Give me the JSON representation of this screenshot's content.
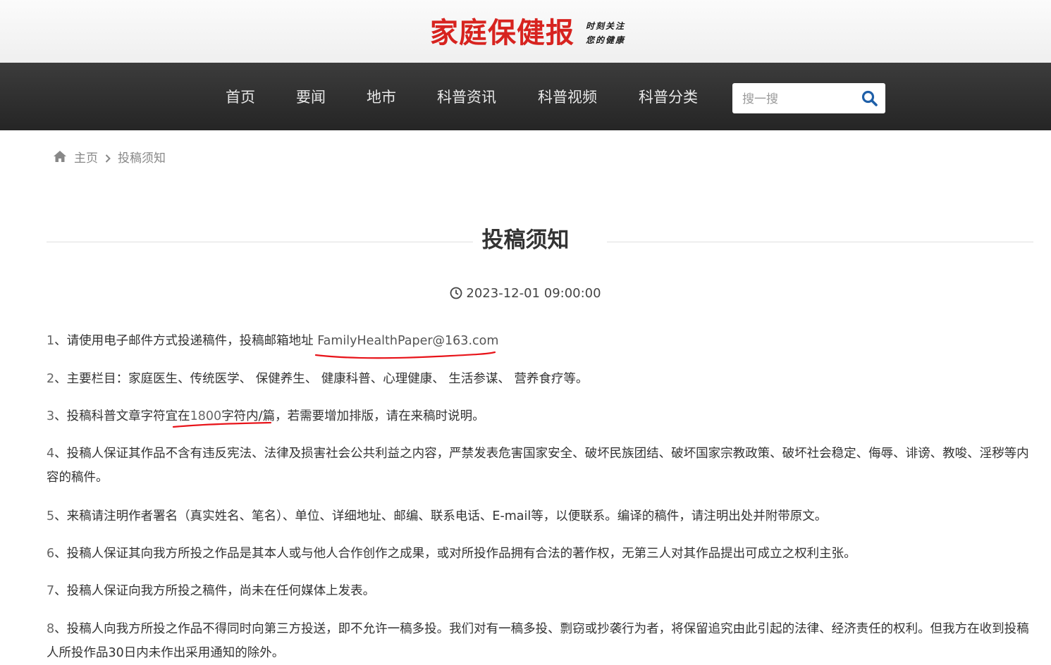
{
  "header": {
    "logo_text": "家庭保健报",
    "slogan_line1": "时刻关注",
    "slogan_line2": "您的健康"
  },
  "nav": {
    "items": [
      "首页",
      "要闻",
      "地市",
      "科普资讯",
      "科普视频",
      "科普分类"
    ],
    "search_placeholder": "搜一搜",
    "search_icon": "search-icon"
  },
  "breadcrumb": {
    "home": "主页",
    "current": "投稿须知"
  },
  "article": {
    "title": "投稿须知",
    "date": "2023-12-01 09:00:00",
    "paragraphs": [
      {
        "num": "1",
        "text": "、请使用电子邮件方式投递稿件，投稿邮箱地址 ",
        "email": "FamilyHealthPaper@163.com"
      },
      {
        "num": "2",
        "text": "、主要栏目：家庭医生、传统医学、 保健养生、 健康科普、心理健康、 生活参谋、 营养食疗等。"
      },
      {
        "num": "3",
        "text_before": "、投稿科普文章字符宜在",
        "chars": "1800",
        "text_after": "字符内/篇，若需要增加排版，请在来稿时说明。"
      },
      {
        "num": "4",
        "text": "、投稿人保证其作品不含有违反宪法、法律及损害社会公共利益之内容，严禁发表危害国家安全、破坏民族团结、破坏国家宗教政策、破坏社会稳定、侮辱、诽谤、教唆、淫秽等内容的稿件。"
      },
      {
        "num": "5",
        "text": "、来稿请注明作者署名（真实姓名、笔名）、单位、详细地址、邮编、联系电话、E-mail等，以便联系。编译的稿件，请注明出处并附带原文。"
      },
      {
        "num": "6",
        "text": "、投稿人保证其向我方所投之作品是其本人或与他人合作创作之成果，或对所投作品拥有合法的著作权，无第三人对其作品提出可成立之权利主张。"
      },
      {
        "num": "7",
        "text": "、投稿人保证向我方所投之稿件，尚未在任何媒体上发表。"
      },
      {
        "num": "8",
        "text": "、投稿人向我方所投之作品不得同时向第三方投送，即不允许一稿多投。我们对有一稿多投、剽窃或抄袭行为者，将保留追究由此引起的法律、经济责任的权利。但我方在收到投稿人所投作品30日内未作出采用通知的除外。"
      }
    ]
  },
  "colors": {
    "logo_red": "#d7231f",
    "nav_bg": "#2e2e2e",
    "search_icon_blue": "#1e5fa8",
    "annotation_red": "#e8141a"
  }
}
